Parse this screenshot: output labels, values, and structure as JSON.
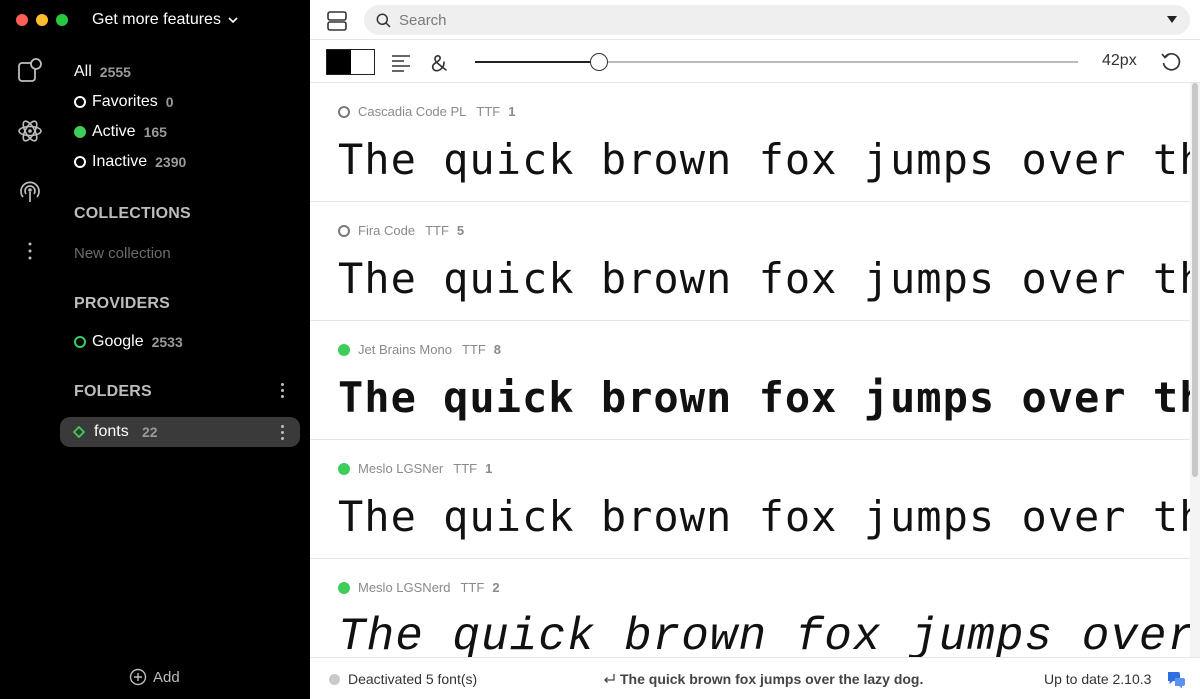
{
  "window": {
    "title": "Get more features"
  },
  "nav": {
    "all": {
      "label": "All",
      "count": "2555"
    },
    "favorites": {
      "label": "Favorites",
      "count": "0"
    },
    "active": {
      "label": "Active",
      "count": "165"
    },
    "inactive": {
      "label": "Inactive",
      "count": "2390"
    }
  },
  "collections": {
    "heading": "COLLECTIONS",
    "new_label": "New collection"
  },
  "providers": {
    "heading": "PROVIDERS",
    "items": [
      {
        "label": "Google",
        "count": "2533"
      }
    ]
  },
  "folders": {
    "heading": "FOLDERS",
    "items": [
      {
        "label": "fonts",
        "count": "22"
      }
    ]
  },
  "sidebar_footer": {
    "add_label": "Add"
  },
  "search": {
    "placeholder": "Search",
    "value": ""
  },
  "toolbar": {
    "size_label": "42px",
    "size_fraction": 0.206
  },
  "sample_text": "The quick brown fox jumps over the lazy dog.",
  "fonts": [
    {
      "name": "Cascadia Code PL",
      "type": "TTF",
      "count": "1",
      "active": false
    },
    {
      "name": "Fira Code",
      "type": "TTF",
      "count": "5",
      "active": false
    },
    {
      "name": "Jet Brains Mono",
      "type": "TTF",
      "count": "8",
      "active": true
    },
    {
      "name": "Meslo LGSNer",
      "type": "TTF",
      "count": "1",
      "active": true
    },
    {
      "name": "Meslo LGSNerd",
      "type": "TTF",
      "count": "2",
      "active": true
    }
  ],
  "status": {
    "left": "Deactivated 5 font(s)",
    "center": "The quick brown fox jumps over the lazy dog.",
    "right": "Up to date 2.10.3"
  },
  "colors": {
    "active_green": "#3ccd5a",
    "sidebar_bg": "#000000",
    "chat_blue": "#2f6fe0"
  }
}
